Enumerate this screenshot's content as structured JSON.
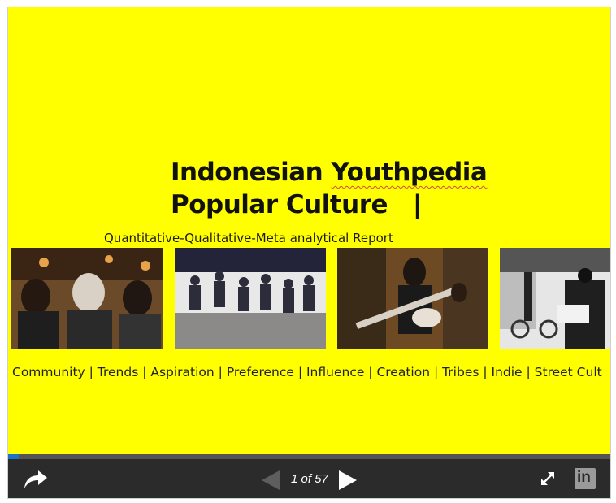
{
  "slide": {
    "title_part1": "Indonesian ",
    "title_part2": "Youthpedia",
    "subtitle": "Popular Culture   |",
    "report_line": "Quantitative-Qualitative-Meta analytical Report",
    "tags_line": "Community | Trends | Aspiration | Preference  | Influence | Creation | Tribes | Indie | Street Cult"
  },
  "player": {
    "current_page": 1,
    "total_pages": 57,
    "counter_text": "1 of 57",
    "progress_fraction": 0.0175,
    "icons": {
      "share": "share-arrow-icon",
      "prev": "triangle-left-icon",
      "next": "triangle-right-icon",
      "fullscreen": "expand-arrows-icon",
      "linkedin": "linkedin-icon"
    },
    "linkedin_label": "in"
  },
  "colors": {
    "slide_background": "#ffff00",
    "controls_background": "#2b2b2b",
    "progress_track": "#555555",
    "progress_fill": "#1a73c4"
  }
}
